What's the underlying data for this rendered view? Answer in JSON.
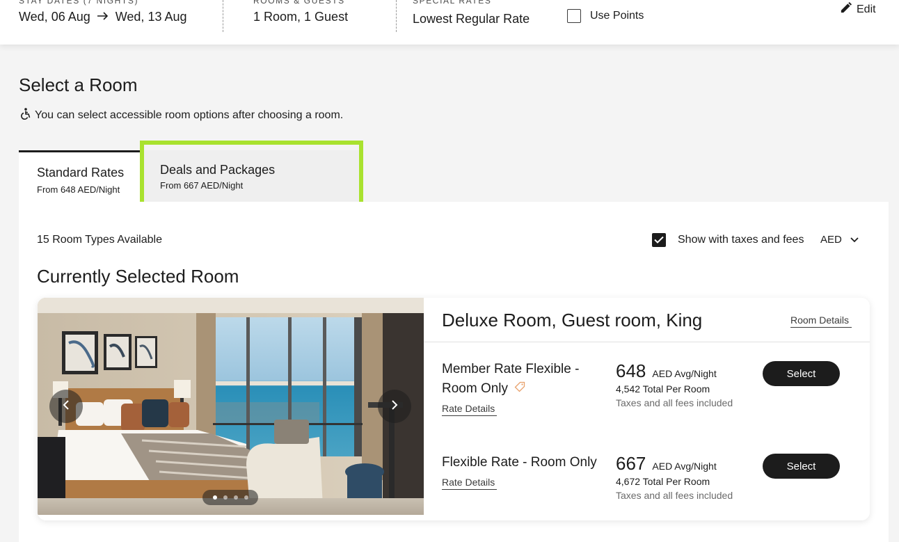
{
  "search_bar": {
    "stay_dates": {
      "label": "STAY DATES (7 NIGHTS)",
      "check_in": "Wed, 06 Aug",
      "check_out": "Wed, 13 Aug"
    },
    "rooms_guests": {
      "label": "ROOMS & GUESTS",
      "value": "1 Room, 1 Guest"
    },
    "special_rates": {
      "label": "SPECIAL RATES",
      "value": "Lowest Regular Rate"
    },
    "use_points": {
      "label": "Use Points",
      "checked": false
    },
    "edit_label": "Edit"
  },
  "page": {
    "title": "Select a Room",
    "accessible_note": "You can select accessible room options after choosing a room."
  },
  "tabs": [
    {
      "title": "Standard Rates",
      "subtitle": "From 648 AED/Night",
      "active": true
    },
    {
      "title": "Deals and Packages",
      "subtitle": "From 667 AED/Night",
      "active": false
    }
  ],
  "results": {
    "room_count": "15 Room Types Available",
    "show_taxes_label": "Show with taxes and fees",
    "show_taxes_checked": true,
    "currency": "AED",
    "section_title": "Currently Selected Room"
  },
  "room": {
    "name": "Deluxe Room, Guest room, King",
    "details_link": "Room Details",
    "photo_count": 4,
    "active_photo": 1,
    "rates": [
      {
        "name_line1": "Member Rate Flexible -",
        "name_line2": "Room Only",
        "details_link": "Rate Details",
        "price": "648",
        "price_unit": "AED Avg/Night",
        "total": "4,542 Total Per Room",
        "fees_note": "Taxes and all fees included",
        "select_label": "Select"
      },
      {
        "name_line1": "Flexible Rate - Room Only",
        "details_link": "Rate Details",
        "price": "667",
        "price_unit": "AED Avg/Night",
        "total": "4,672 Total Per Room",
        "fees_note": "Taxes and all fees included",
        "select_label": "Select"
      }
    ]
  },
  "colors": {
    "highlight": "#a9e22f",
    "button": "#1c1c1c",
    "background": "#f4f4f4",
    "member_tag": "#e8a06a"
  },
  "icons": [
    "arrow-right-icon",
    "pencil-icon",
    "accessibility-icon",
    "chevron-down-icon",
    "check-icon",
    "chevron-left-icon",
    "chevron-right-icon",
    "tag-icon"
  ]
}
